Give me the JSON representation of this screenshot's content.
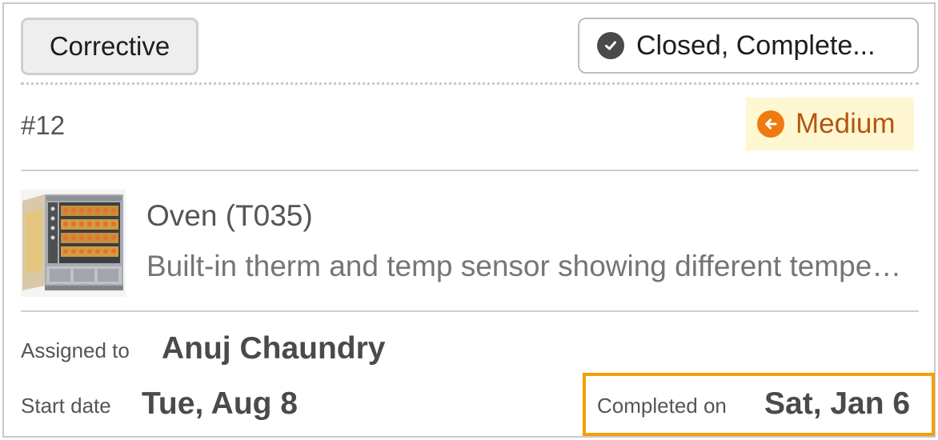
{
  "work_order": {
    "type_label": "Corrective",
    "status_label": "Closed, Complete...",
    "id": "#12",
    "priority_label": "Medium",
    "asset_name": "Oven (T035)",
    "description": "Built-in therm and temp sensor showing different temperatures",
    "assigned_label": "Assigned to",
    "assigned_value": "Anuj Chaundry",
    "start_label": "Start date",
    "start_value": "Tue, Aug 8",
    "completed_label": "Completed on",
    "completed_value": "Sat, Jan 6"
  },
  "colors": {
    "priority_text": "#b4560e",
    "priority_bg": "#fff7d1",
    "priority_icon": "#f07a12",
    "highlight_border": "#f59e0b"
  },
  "icons": {
    "status": "check-circle-icon",
    "priority": "arrow-left-circle-icon"
  }
}
